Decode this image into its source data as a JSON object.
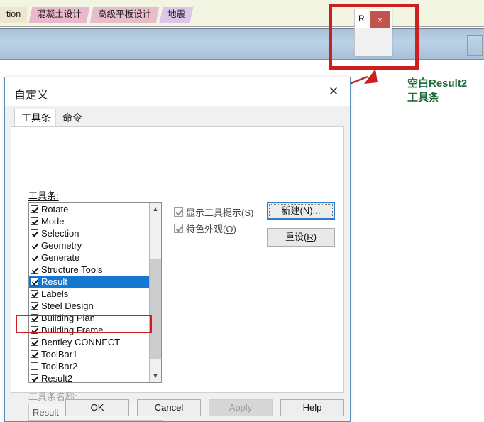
{
  "app": {
    "ribbon_tabs": [
      {
        "label": "tion",
        "style": "tan"
      },
      {
        "label": "混凝土设计",
        "style": "pink"
      },
      {
        "label": "高级平板设计",
        "style": "rose"
      },
      {
        "label": "地震",
        "style": "lilac"
      }
    ]
  },
  "floating_toolbar": {
    "title": "R",
    "close_label": "×"
  },
  "annotation": {
    "label_line1": "空白Result2",
    "label_line2": "工具条",
    "color": "#1f6b3a",
    "highlight_color": "#cc1f1f"
  },
  "dialog": {
    "title": "自定义",
    "close_label": "✕",
    "tabs": [
      {
        "label": "工具条",
        "active": true
      },
      {
        "label": "命令",
        "active": false
      }
    ],
    "toolbars_label": "工具条:",
    "toolbars_list": [
      {
        "label": "Rotate",
        "checked": true,
        "selected": false
      },
      {
        "label": "Mode",
        "checked": true,
        "selected": false
      },
      {
        "label": "Selection",
        "checked": true,
        "selected": false
      },
      {
        "label": "Geometry",
        "checked": true,
        "selected": false
      },
      {
        "label": "Generate",
        "checked": true,
        "selected": false
      },
      {
        "label": "Structure Tools",
        "checked": true,
        "selected": false
      },
      {
        "label": "Result",
        "checked": true,
        "selected": true
      },
      {
        "label": "Labels",
        "checked": true,
        "selected": false
      },
      {
        "label": "Steel Design",
        "checked": true,
        "selected": false
      },
      {
        "label": "Building Plan",
        "checked": true,
        "selected": false
      },
      {
        "label": "Building Frame",
        "checked": true,
        "selected": false
      },
      {
        "label": "Bentley CONNECT",
        "checked": true,
        "selected": false
      },
      {
        "label": "ToolBar1",
        "checked": true,
        "selected": false
      },
      {
        "label": "ToolBar2",
        "checked": false,
        "selected": false
      },
      {
        "label": "Result2",
        "checked": true,
        "selected": false
      }
    ],
    "scrollbar": {
      "up_glyph": "▲",
      "down_glyph": "▼"
    },
    "options": [
      {
        "label_main": "显示工具提示(",
        "mnemonic": "S",
        "label_tail": ")",
        "checked": true
      },
      {
        "label_main": "特色外观(",
        "mnemonic": "O",
        "label_tail": ")",
        "checked": true
      }
    ],
    "new_button": {
      "label_main": "新建(",
      "mnemonic": "N",
      "label_tail": ")..."
    },
    "reset_button": {
      "label_main": "重设(",
      "mnemonic": "R",
      "label_tail": ")"
    },
    "name_label": "工具条名称:",
    "name_value": "Result",
    "footer": {
      "ok": "OK",
      "cancel": "Cancel",
      "apply": "Apply",
      "help": "Help"
    }
  }
}
